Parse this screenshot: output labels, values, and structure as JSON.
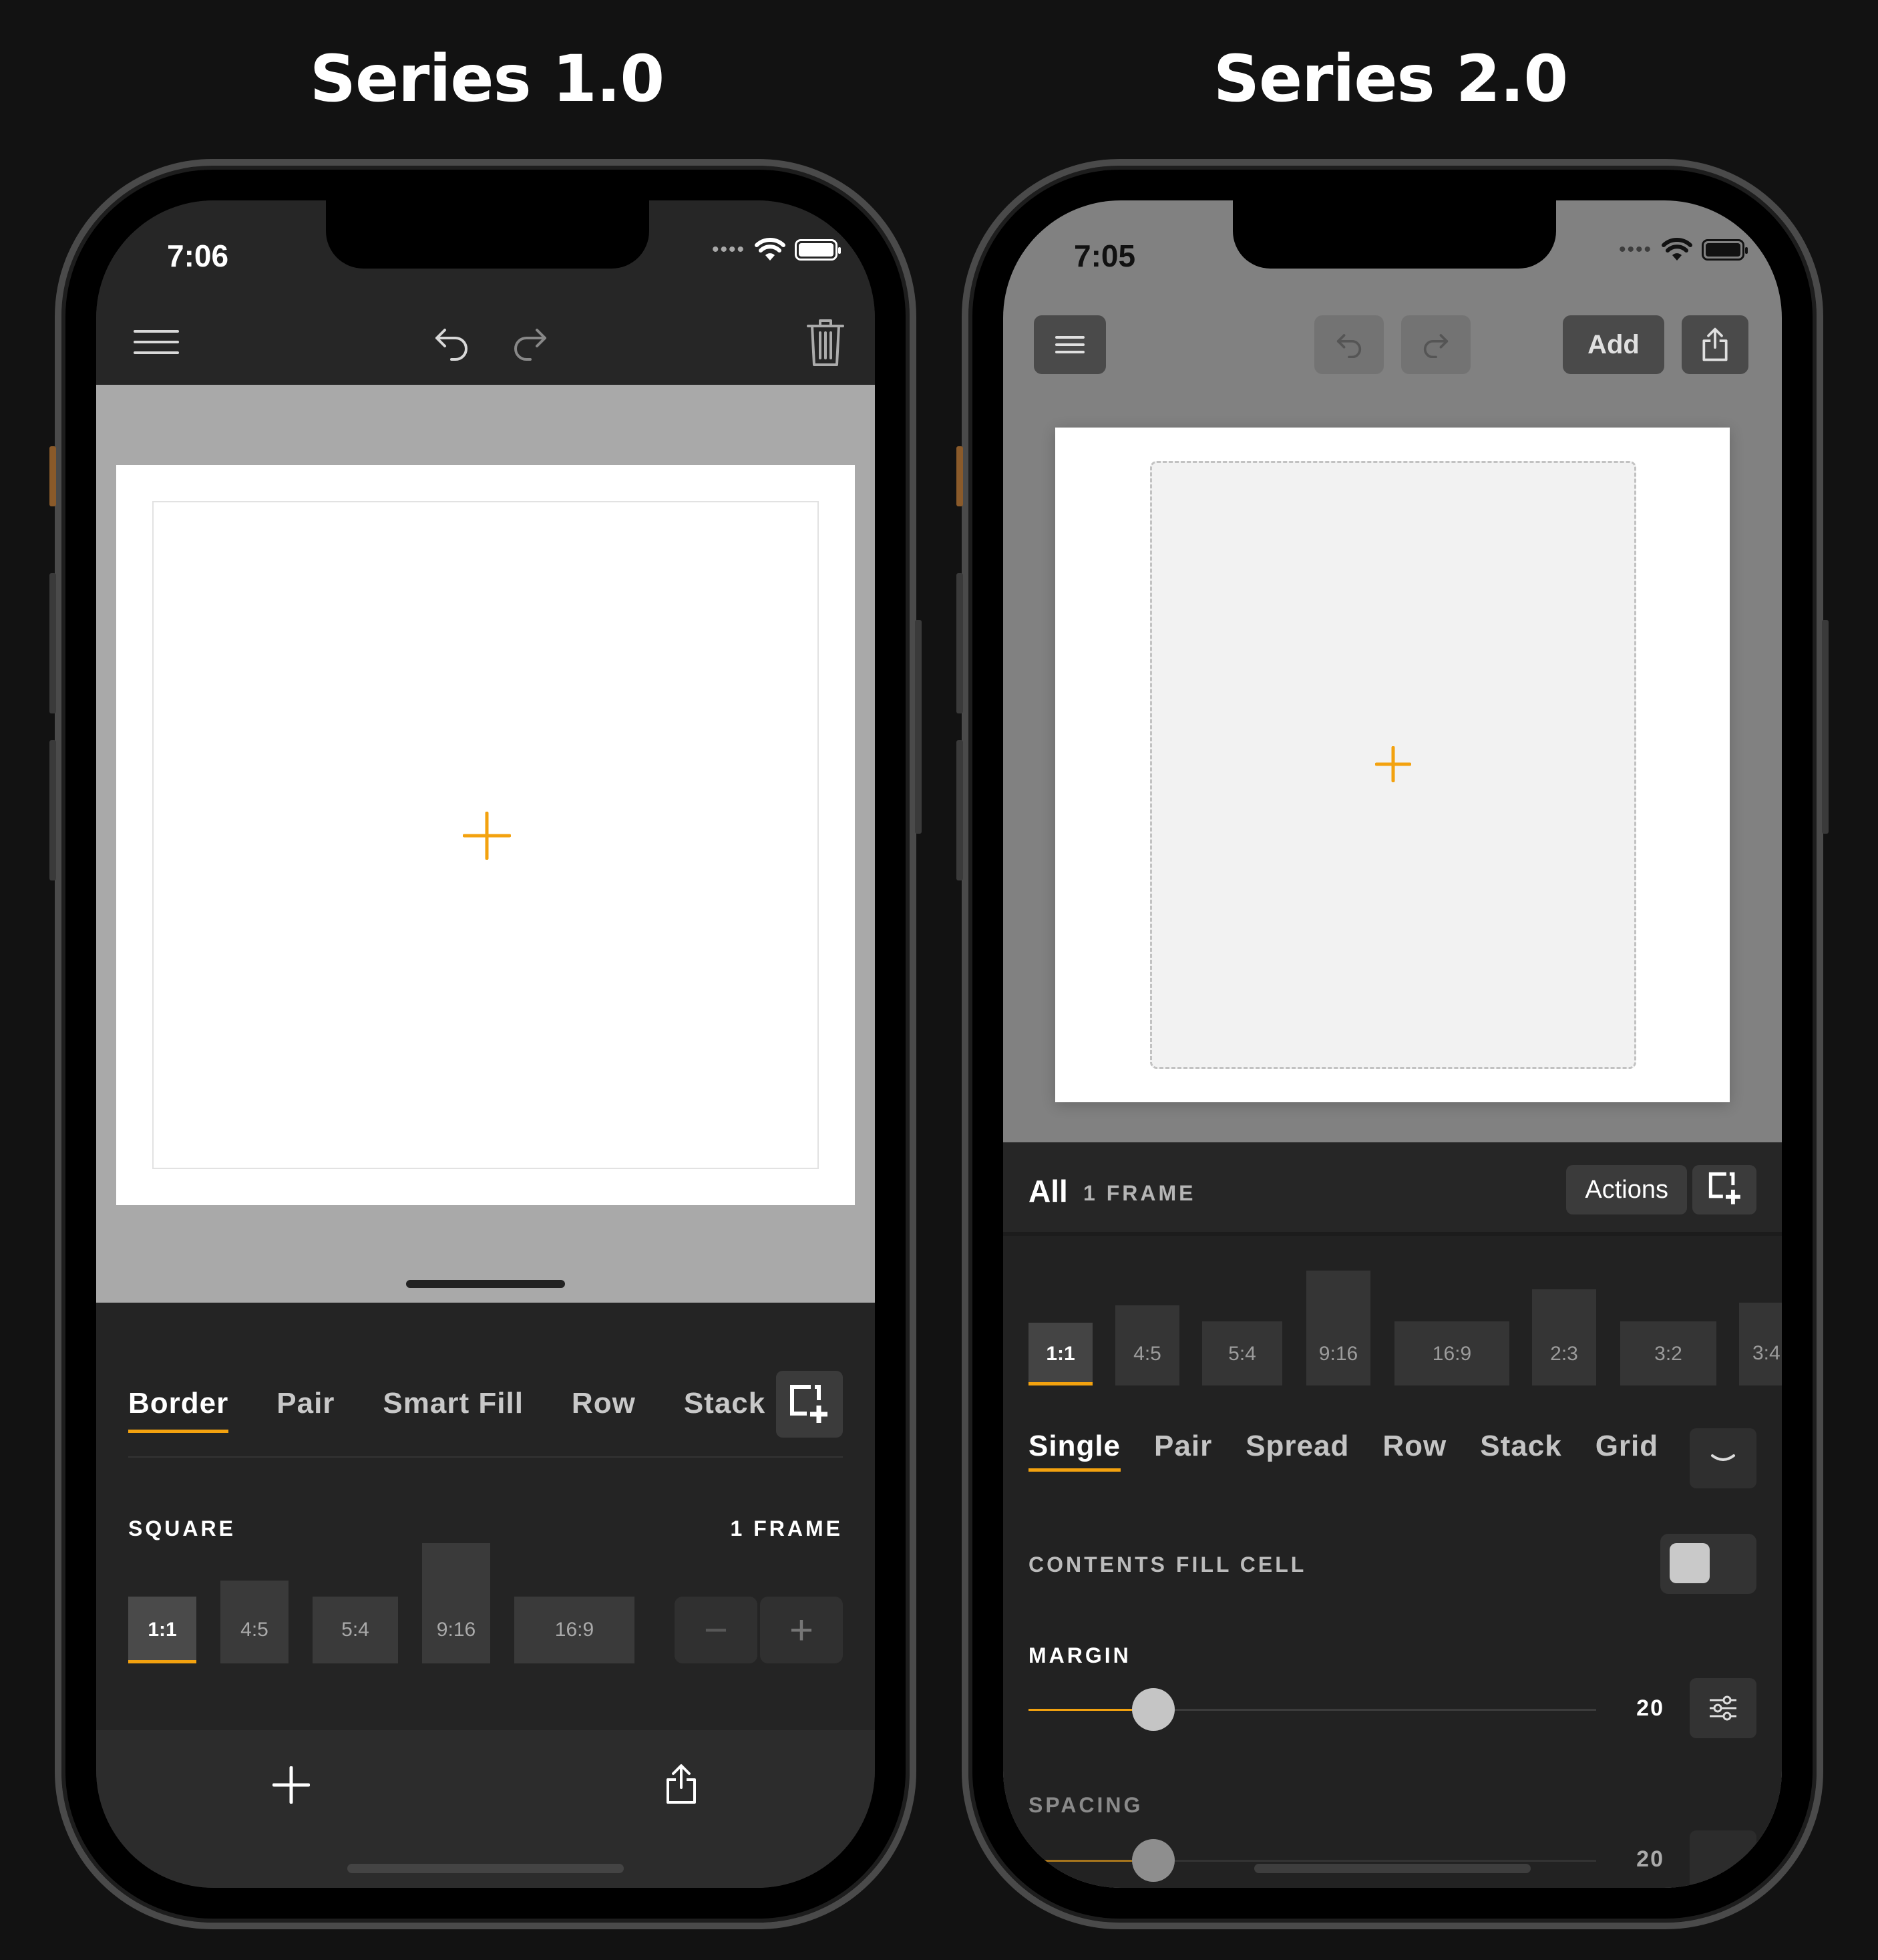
{
  "titles": {
    "left": "Series 1.0",
    "right": "Series 2.0"
  },
  "colors": {
    "accent": "#f3a20f",
    "background": "#121212"
  },
  "phone1": {
    "status": {
      "time": "7:06"
    },
    "toolbar": {
      "icons": [
        "menu-icon",
        "undo-icon",
        "redo-icon",
        "trash-icon"
      ]
    },
    "tabs": [
      {
        "label": "Border",
        "active": true
      },
      {
        "label": "Pair"
      },
      {
        "label": "Smart Fill"
      },
      {
        "label": "Row"
      },
      {
        "label": "Stack"
      }
    ],
    "format_label": "SQUARE",
    "frame_count": "1 FRAME",
    "ratios": [
      {
        "label": "1:1",
        "active": true
      },
      {
        "label": "4:5"
      },
      {
        "label": "5:4"
      },
      {
        "label": "9:16"
      },
      {
        "label": "16:9"
      }
    ],
    "stepper": {
      "minus": "−",
      "plus": "+"
    },
    "bottom_icons": [
      "plus-icon",
      "share-icon"
    ]
  },
  "phone2": {
    "status": {
      "time": "7:05"
    },
    "toolbar": {
      "add_label": "Add",
      "icons": [
        "menu-icon",
        "undo-icon",
        "redo-icon",
        "share-icon"
      ]
    },
    "header": {
      "all_label": "All",
      "frame_count": "1 FRAME",
      "actions_label": "Actions"
    },
    "ratios": [
      {
        "label": "1:1",
        "active": true
      },
      {
        "label": "4:5"
      },
      {
        "label": "5:4"
      },
      {
        "label": "9:16"
      },
      {
        "label": "16:9"
      },
      {
        "label": "2:3"
      },
      {
        "label": "3:2"
      },
      {
        "label": "3:4"
      }
    ],
    "layout_tabs": [
      {
        "label": "Single",
        "active": true
      },
      {
        "label": "Pair"
      },
      {
        "label": "Spread"
      },
      {
        "label": "Row"
      },
      {
        "label": "Stack"
      },
      {
        "label": "Grid"
      }
    ],
    "contents_fill_label": "CONTENTS FILL CELL",
    "contents_fill_on": false,
    "margin": {
      "label": "MARGIN",
      "value": "20"
    },
    "spacing": {
      "label": "SPACING",
      "value": "20"
    }
  }
}
